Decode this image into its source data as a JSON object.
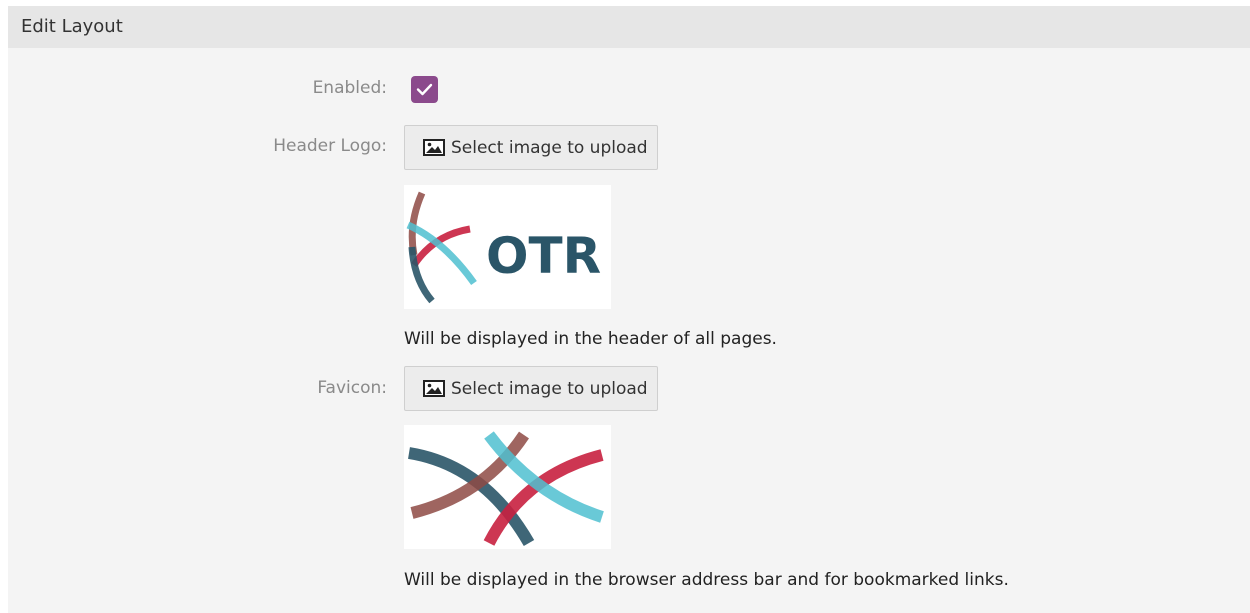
{
  "panel": {
    "title": "Edit Layout"
  },
  "form": {
    "enabled": {
      "label": "Enabled:",
      "checked": true,
      "color": "#8b4a8c"
    },
    "header_logo": {
      "label": "Header Logo:",
      "button_label": "Select image to upload",
      "button_icon": "image-icon",
      "preview_text": "OTR",
      "description": "Will be displayed in the header of all pages."
    },
    "favicon": {
      "label": "Favicon:",
      "button_label": "Select image to upload",
      "button_icon": "image-icon",
      "description": "Will be displayed in the browser address bar and for bookmarked links."
    }
  },
  "colors": {
    "panel_bg": "#f4f4f4",
    "header_bg": "#e6e6e6",
    "logo_teal": "#2a5568",
    "logo_red": "#c8203f",
    "logo_cyan": "#4fc0d0",
    "logo_brown": "#8e4a44"
  }
}
